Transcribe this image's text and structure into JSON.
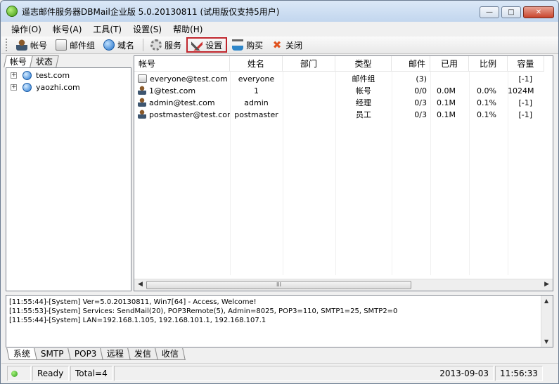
{
  "window": {
    "title": "遥志邮件服务器DBMail企业版 5.0.20130811 (试用版仅支持5用户)",
    "buttons": {
      "minimize": "—",
      "maximize": "□",
      "close": "✕"
    }
  },
  "menubar": [
    "操作(O)",
    "帐号(A)",
    "工具(T)",
    "设置(S)",
    "帮助(H)"
  ],
  "toolbar": {
    "account": "帐号",
    "mailgroup": "邮件组",
    "domain": "域名",
    "service": "服务",
    "settings": "设置",
    "buy": "购买",
    "close": "关闭"
  },
  "left": {
    "tabs": [
      "帐号",
      "状态"
    ],
    "domains": [
      "test.com",
      "yaozhi.com"
    ]
  },
  "list": {
    "columns": [
      "帐号",
      "姓名",
      "部门",
      "类型",
      "邮件",
      "已用",
      "比例",
      "容量"
    ],
    "rows": [
      {
        "type_icon": "group-icon",
        "account": "everyone@test.com",
        "name": "everyone",
        "dept": "",
        "kind": "邮件组",
        "mail": "(3)",
        "used": "",
        "ratio": "",
        "cap": "[-1]"
      },
      {
        "type_icon": "user-icon",
        "account": "1@test.com",
        "name": "1",
        "dept": "",
        "kind": "帐号",
        "mail": "0/0",
        "used": "0.0M",
        "ratio": "0.0%",
        "cap": "1024M"
      },
      {
        "type_icon": "user-icon",
        "account": "admin@test.com",
        "name": "admin",
        "dept": "",
        "kind": "经理",
        "mail": "0/3",
        "used": "0.1M",
        "ratio": "0.1%",
        "cap": "[-1]"
      },
      {
        "type_icon": "user-icon",
        "account": "postmaster@test.com",
        "name": "postmaster",
        "dept": "",
        "kind": "员工",
        "mail": "0/3",
        "used": "0.1M",
        "ratio": "0.1%",
        "cap": "[-1]"
      }
    ],
    "scroll_grip": "III"
  },
  "log": [
    "[11:55:44]-[System] Ver=5.0.20130811, Win7[64] - Access, Welcome!",
    "[11:55:53]-[System] Services: SendMail(20), POP3Remote(5), Admin=8025, POP3=110, SMTP1=25, SMTP2=0",
    "[11:55:44]-[System] LAN=192.168.1.105, 192.168.101.1, 192.168.107.1"
  ],
  "bottom_tabs": [
    "系统",
    "SMTP",
    "POP3",
    "远程",
    "发信",
    "收信"
  ],
  "status": {
    "ready": "Ready",
    "total": "Total=4",
    "date": "2013-09-03",
    "time": "11:56:33"
  }
}
